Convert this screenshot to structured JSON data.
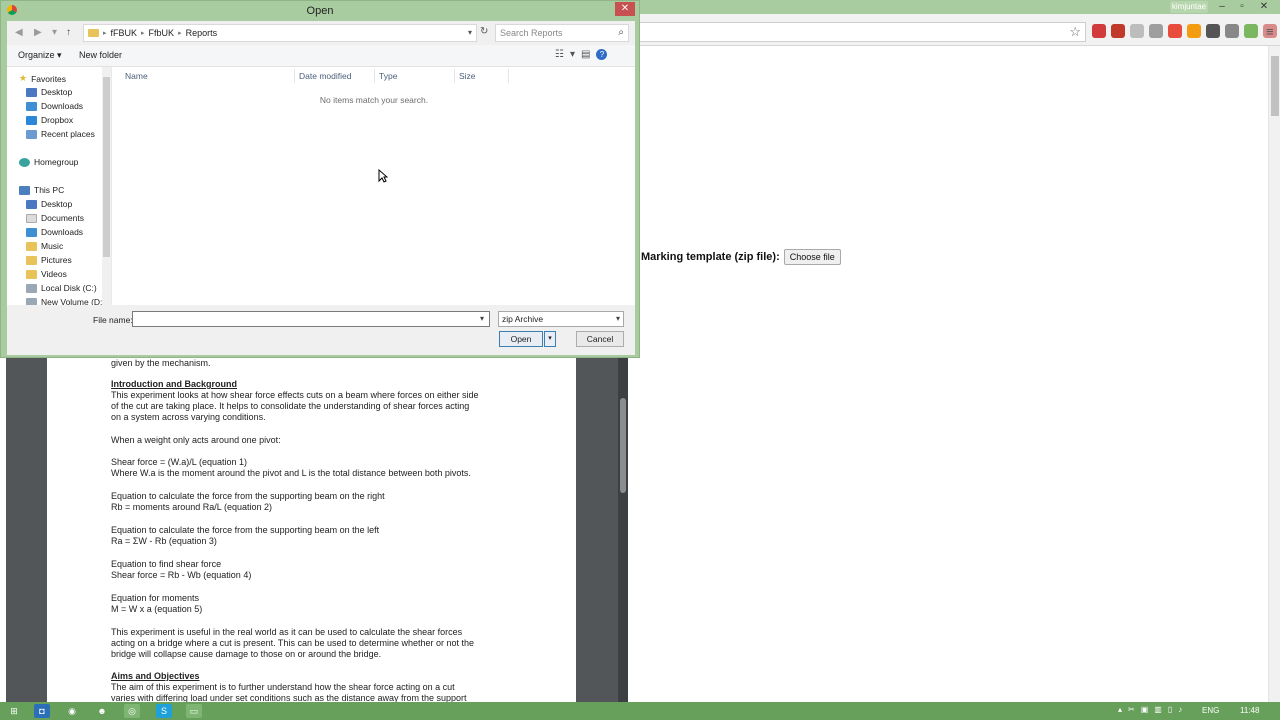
{
  "browser": {
    "user_name": "kimjuntae",
    "window_controls": [
      "–",
      "▫",
      "✕"
    ],
    "background_colors": {
      "titlebar": "#a9cba0",
      "taskbar": "#66a05b"
    }
  },
  "marking": {
    "label": "Marking template (zip file):",
    "button_label": "Choose file"
  },
  "dialog": {
    "title": "Open",
    "breadcrumbs": [
      "fFBUK",
      "FfbUK",
      "Reports"
    ],
    "search_placeholder": "Search Reports",
    "organize_label": "Organize",
    "new_folder_label": "New folder",
    "columns": [
      "Name",
      "Date modified",
      "Type",
      "Size"
    ],
    "empty_message": "No items match your search.",
    "tree": {
      "favorites": "Favorites",
      "favorites_items": [
        "Desktop",
        "Downloads",
        "Dropbox",
        "Recent places"
      ],
      "homegroup": "Homegroup",
      "this_pc": "This PC",
      "pc_items": [
        "Desktop",
        "Documents",
        "Downloads",
        "Music",
        "Pictures",
        "Videos",
        "Local Disk (C:)",
        "New Volume (D:)"
      ]
    },
    "file_name_label": "File name:",
    "file_name_value": "",
    "file_type": "zip Archive",
    "open_label": "Open",
    "cancel_label": "Cancel"
  },
  "pdf": {
    "lines": [
      {
        "text": "given by the mechanism.",
        "style": "normal"
      },
      {
        "text": "Introduction and Background",
        "style": "heading"
      },
      {
        "text": "This experiment looks at how shear force effects cuts on a beam where forces on either side",
        "style": "normal"
      },
      {
        "text": "of the cut are taking place. It helps to consolidate the understanding of shear forces acting",
        "style": "normal"
      },
      {
        "text": "on a system across varying conditions.",
        "style": "normal"
      },
      {
        "text": "When a weight only acts around one pivot:",
        "style": "normal"
      },
      {
        "text": "Shear force = (W.a)/L  (equation 1)",
        "style": "normal"
      },
      {
        "text": "Where W.a is the moment around the pivot and L is the total distance between both pivots.",
        "style": "normal"
      },
      {
        "text": "Equation to calculate the force from the supporting beam on the right",
        "style": "normal"
      },
      {
        "text": "Rb = moments around Ra/L  (equation 2)",
        "style": "normal"
      },
      {
        "text": "Equation to calculate the force from the supporting beam on the left",
        "style": "normal"
      },
      {
        "text": "Ra = ΣW - Rb (equation 3)",
        "style": "normal"
      },
      {
        "text": "Equation to find shear force",
        "style": "normal"
      },
      {
        "text": "Shear force = Rb - Wb (equation 4)",
        "style": "normal"
      },
      {
        "text": "Equation for moments",
        "style": "normal"
      },
      {
        "text": "M = W x a (equation 5)",
        "style": "normal"
      },
      {
        "text": "This experiment is useful in the real world as it can be used to calculate the shear forces",
        "style": "normal"
      },
      {
        "text": "acting on a bridge where a cut is present. This can be used to determine whether or not the",
        "style": "normal"
      },
      {
        "text": "bridge will collapse cause damage to those on or around the bridge.",
        "style": "normal"
      },
      {
        "text": "Aims and Objectives",
        "style": "heading"
      },
      {
        "text": "The aim of this experiment is to further understand how the shear force acting on a cut",
        "style": "normal"
      },
      {
        "text": "varies with differing load under set conditions such as the distance away from the support",
        "style": "normal"
      }
    ]
  },
  "taskbar": {
    "language": "ENG",
    "time": "11:48"
  }
}
